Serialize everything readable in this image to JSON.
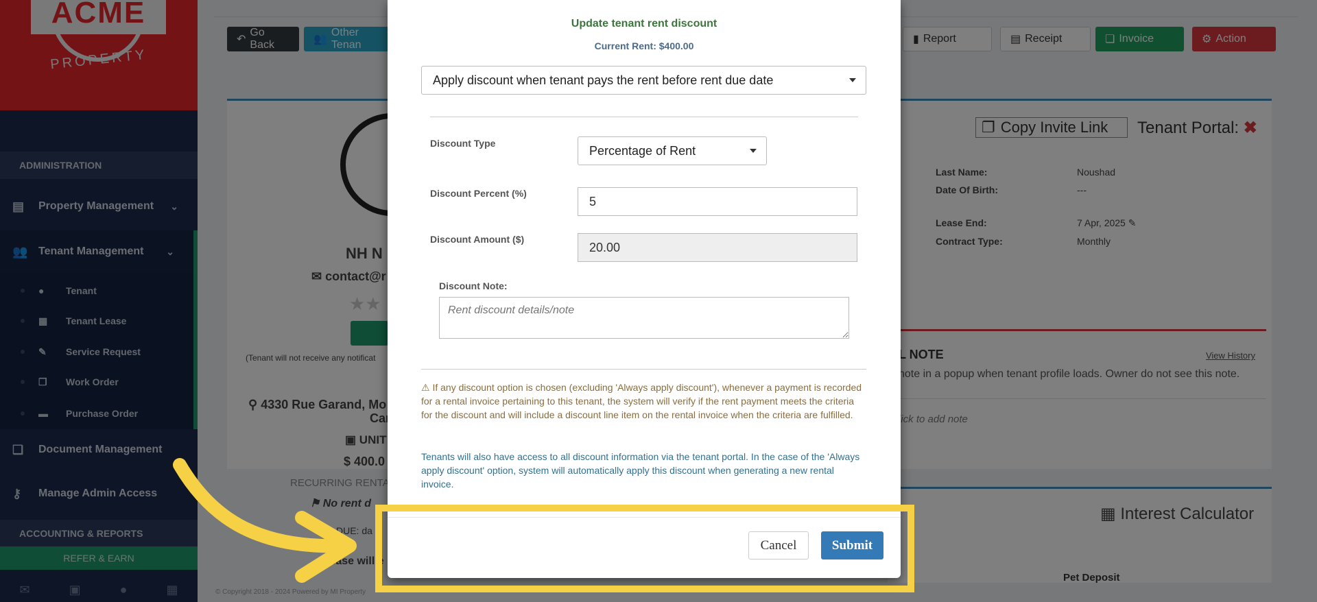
{
  "sidebar": {
    "logo_text": "ACME",
    "logo_sub": "PROPERTY",
    "admin_header": "ADMINISTRATION",
    "items": [
      {
        "label": "Property Management"
      },
      {
        "label": "Tenant Management"
      },
      {
        "label": "Document Management"
      },
      {
        "label": "Manage Admin Access"
      }
    ],
    "sub_items": [
      {
        "label": "Tenant"
      },
      {
        "label": "Tenant Lease"
      },
      {
        "label": "Service Request"
      },
      {
        "label": "Work Order"
      },
      {
        "label": "Purchase Order"
      }
    ],
    "accounting_header": "ACCOUNTING & REPORTS",
    "refer_label": "REFER & EARN"
  },
  "toolbar": {
    "go_back": "Go Back",
    "other_tenants": "Other Tenan",
    "report": "Report",
    "receipt": "Receipt",
    "invoice": "Invoice",
    "action": "Action"
  },
  "profile": {
    "name_partial": "NH N",
    "email_partial": "contact@r",
    "notify_note": "(Tenant will not receive any notificat",
    "address_line1": "4330 Rue Garand, Mo",
    "address_line2": "Can",
    "unit": "UNIT",
    "rent": "$ 400.0",
    "recurring": "RECURRING RENTA",
    "no_rent": "No rent d",
    "due": "DUE: da",
    "lease": "lease will e"
  },
  "details": {
    "last_name_label": "Last Name:",
    "last_name_value": "Noushad",
    "dob_label": "Date Of Birth:",
    "dob_value": "---",
    "lease_end_label": "Lease End:",
    "lease_end_value": "7 Apr, 2025",
    "contract_label": "Contract Type:",
    "contract_value": "Monthly",
    "copy_invite": "Copy Invite Link",
    "tenant_portal": "Tenant Portal:"
  },
  "note_panel": {
    "title": "L NOTE",
    "view_history": "View History",
    "desc": "note in a popup when tenant profile loads. Owner do not see this note.",
    "placeholder": "lick to add note"
  },
  "interest_calc": "Interest Calculator",
  "pet_deposit": "Pet Deposit",
  "copyright": "© Copyright 2018 - 2024 Powered by MI Property",
  "modal": {
    "title": "Update tenant rent discount",
    "current_rent": "Current Rent: $400.00",
    "discount_option": "Apply discount when tenant pays the rent before rent due date",
    "discount_type_label": "Discount Type",
    "discount_type_value": "Percentage of Rent",
    "discount_percent_label": "Discount Percent (%)",
    "discount_percent_value": "5",
    "discount_amount_label": "Discount Amount ($)",
    "discount_amount_value": "20.00",
    "discount_note_label": "Discount Note:",
    "discount_note_placeholder": "Rent discount details/note",
    "warning_text": "If any discount option is chosen (excluding 'Always apply discount'), whenever a payment is recorded for a rental invoice pertaining to this tenant, the system will verify if the rent payment meets the criteria for the discount and will include a discount line item on the rental invoice when the criteria are fulfilled.",
    "info_text": "Tenants will also have access to all discount information via the tenant portal. In the case of the 'Always apply discount' option, system will automatically apply this discount when generating a new rental invoice.",
    "cancel_label": "Cancel",
    "submit_label": "Submit"
  },
  "colors": {
    "highlight": "#f6d045",
    "submit": "#337ab7",
    "sidebar": "#1b2a4e",
    "brand_red": "#e8262d"
  }
}
